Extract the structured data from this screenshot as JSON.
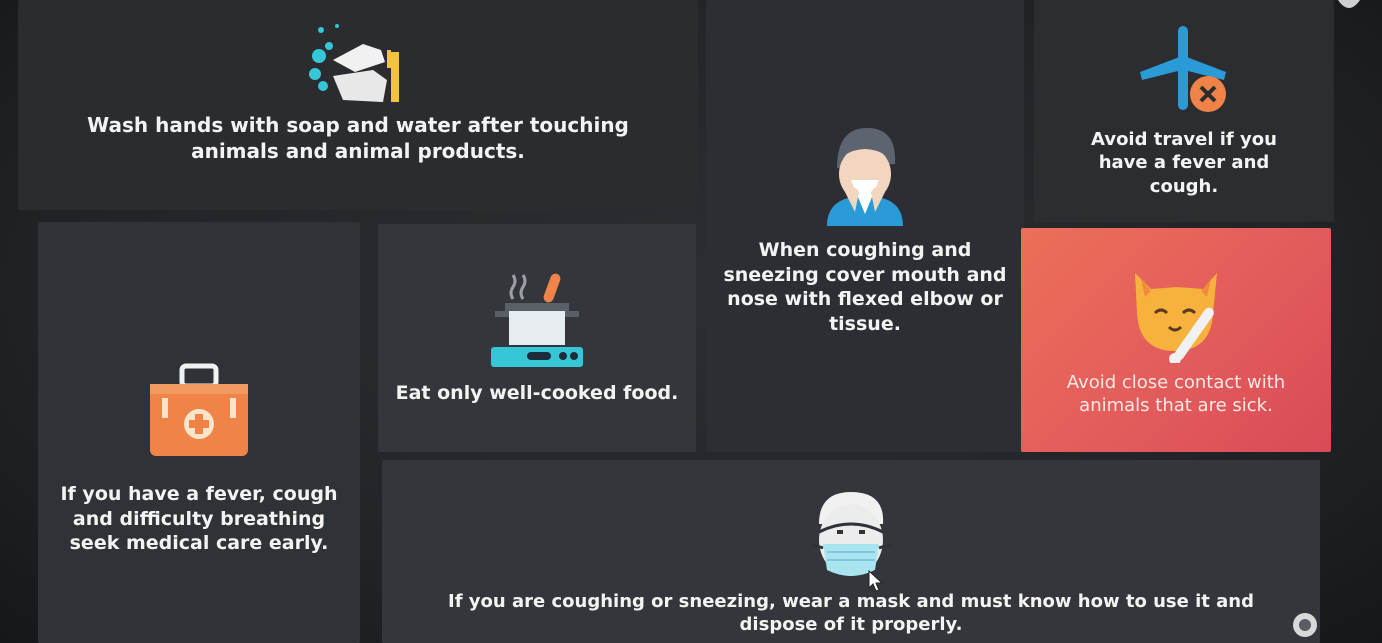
{
  "tiles": {
    "wash": {
      "text": "Wash hands with soap and water after touching animals and animal products.",
      "icon": "hand-washing-icon"
    },
    "fever": {
      "text": "If you have a fever, cough and difficulty breathing seek medical care early.",
      "icon": "first-aid-kit-icon"
    },
    "food": {
      "text": "Eat only well-cooked food.",
      "icon": "cooking-pot-icon"
    },
    "cough": {
      "text": "When coughing and sneezing cover mouth and nose with flexed elbow or tissue.",
      "icon": "sneezing-person-icon"
    },
    "travel": {
      "text": "Avoid travel if you have a fever and cough.",
      "icon": "no-airplane-icon"
    },
    "sick_animals": {
      "text": "Avoid close contact with animals that are sick.",
      "icon": "sick-cat-icon"
    },
    "mask": {
      "text": "If you are coughing or sneezing, wear a mask and must know how to use it and dispose of it properly.",
      "icon": "face-mask-icon"
    }
  },
  "colors": {
    "tile_dark": "#2e3035",
    "tile_highlight": "#e5615a",
    "text": "#f3f3f3"
  }
}
